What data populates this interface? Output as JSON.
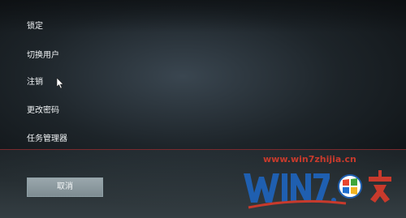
{
  "menu": {
    "items": [
      {
        "label": "锁定"
      },
      {
        "label": "切换用户"
      },
      {
        "label": "注销"
      },
      {
        "label": "更改密码"
      },
      {
        "label": "任务管理器"
      }
    ]
  },
  "footer": {
    "cancel_label": "取消"
  },
  "watermark": {
    "url": "www.win7zhijia.cn",
    "logo_text": "WIN7.之家"
  },
  "colors": {
    "divider": "#7a2a2e",
    "watermark_red": "#c83a2c",
    "watermark_blue": "#1f5fb0"
  }
}
